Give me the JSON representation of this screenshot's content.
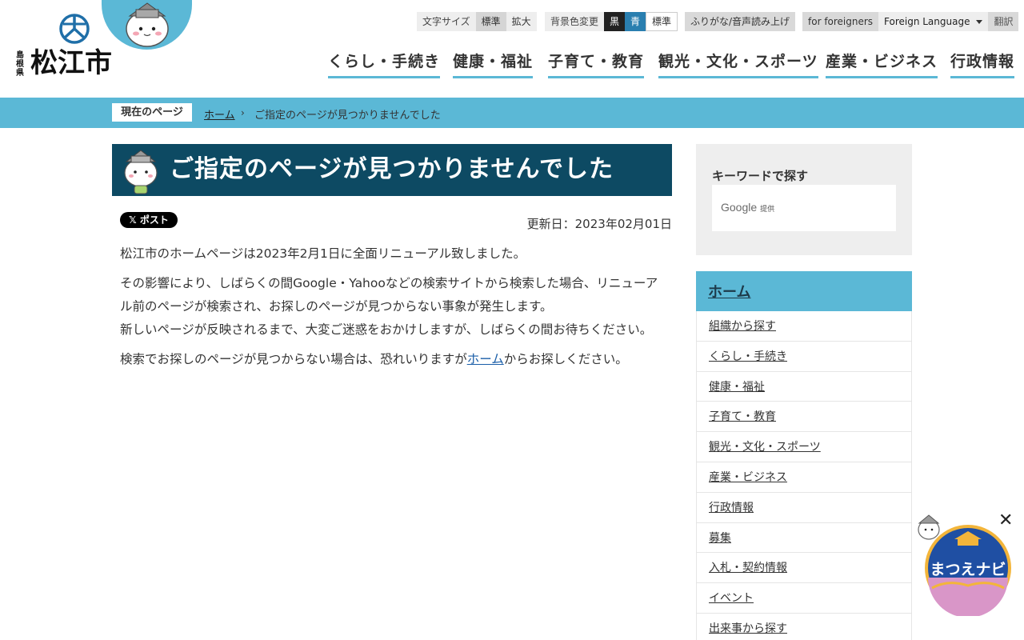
{
  "header": {
    "logo": {
      "pref": "島根県",
      "city": "松江市"
    },
    "text_size": {
      "label": "文字サイズ",
      "options": [
        "標準",
        "拡大"
      ]
    },
    "bg_color": {
      "label": "背景色変更",
      "options": [
        "黒",
        "青",
        "標準"
      ]
    },
    "furigana": "ふりがな/音声読み上げ",
    "foreigners": "for foreigners",
    "language": {
      "selected": "Foreign Language",
      "translate": "翻訳"
    },
    "nav": [
      "くらし・手続き",
      "健康・福祉",
      "子育て・教育",
      "観光・文化・スポーツ",
      "産業・ビジネス",
      "行政情報"
    ]
  },
  "breadcrumb": {
    "label": "現在のページ",
    "home": "ホーム",
    "separator": "›",
    "current": "ご指定のページが見つかりませんでした"
  },
  "main": {
    "title": "ご指定のページが見つかりませんでした",
    "post_button": "𝕏 ポスト",
    "updated": "更新日：2023年02月01日",
    "para1": "松江市のホームページは2023年2月1日に全面リニューアル致しました。",
    "para2": "その影響により、しばらくの間Google・Yahooなどの検索サイトから検索した場合、リニューアル前のページが検索され、お探しのページが見つからない事象が発生します。",
    "para3": "新しいページが反映されるまで、大変ご迷惑をおかけしますが、しばらくの間お待ちください。",
    "para4_before": "検索でお探しのページが見つからない場合は、恐れいりますが",
    "para4_link": "ホーム",
    "para4_after": "からお探しください。"
  },
  "sidebar": {
    "keyword_title": "キーワードで探す",
    "google_label": "Google",
    "google_suffix": "提供",
    "nav_head": "ホーム",
    "items": [
      "組織から探す",
      "くらし・手続き",
      "健康・福祉",
      "子育て・教育",
      "観光・文化・スポーツ",
      "産業・ビジネス",
      "行政情報",
      "募集",
      "入札・契約情報",
      "イベント",
      "出来事から探す"
    ]
  },
  "navi": {
    "label": "まつえナビ",
    "close": "✕"
  },
  "colors": {
    "accent": "#5bb8d6",
    "title_bg": "#0d4a63",
    "link": "#1a5ea8"
  }
}
